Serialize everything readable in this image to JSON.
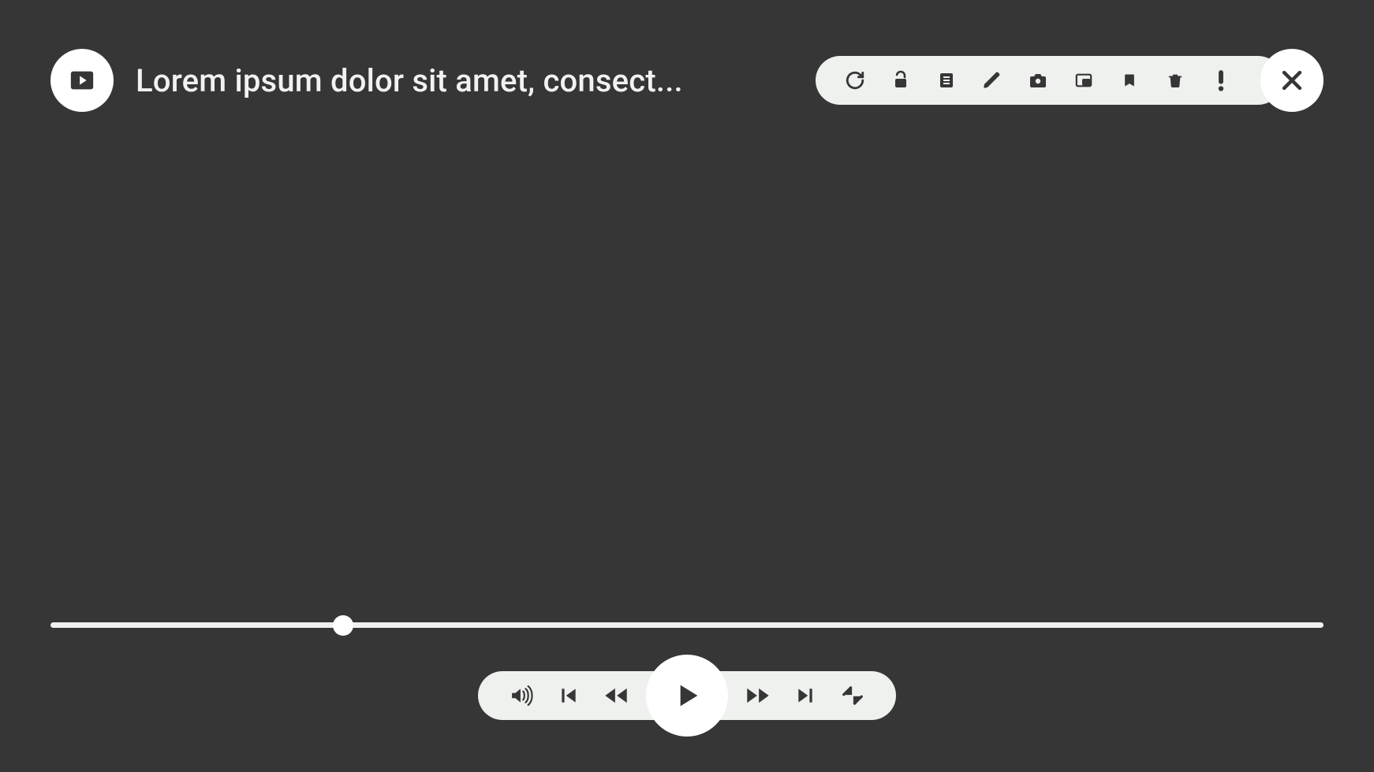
{
  "header": {
    "title": "Lorem ipsum dolor sit amet, consect..."
  },
  "toolbar": {
    "items": [
      {
        "name": "refresh-icon"
      },
      {
        "name": "lock-open-icon"
      },
      {
        "name": "notes-icon"
      },
      {
        "name": "edit-icon"
      },
      {
        "name": "camera-icon"
      },
      {
        "name": "pip-icon"
      },
      {
        "name": "bookmark-icon"
      },
      {
        "name": "trash-icon"
      },
      {
        "name": "alert-icon"
      }
    ]
  },
  "progress": {
    "percent": 23
  },
  "player": {
    "buttons_left": [
      {
        "name": "volume-icon"
      },
      {
        "name": "skip-previous-icon"
      },
      {
        "name": "rewind-icon"
      }
    ],
    "buttons_right": [
      {
        "name": "fast-forward-icon"
      },
      {
        "name": "skip-next-icon"
      },
      {
        "name": "collapse-icon"
      }
    ]
  },
  "colors": {
    "background": "#363636",
    "pill": "#eef1ee",
    "circle": "#ffffff",
    "icon": "#363636",
    "text": "#f2f2f2"
  }
}
